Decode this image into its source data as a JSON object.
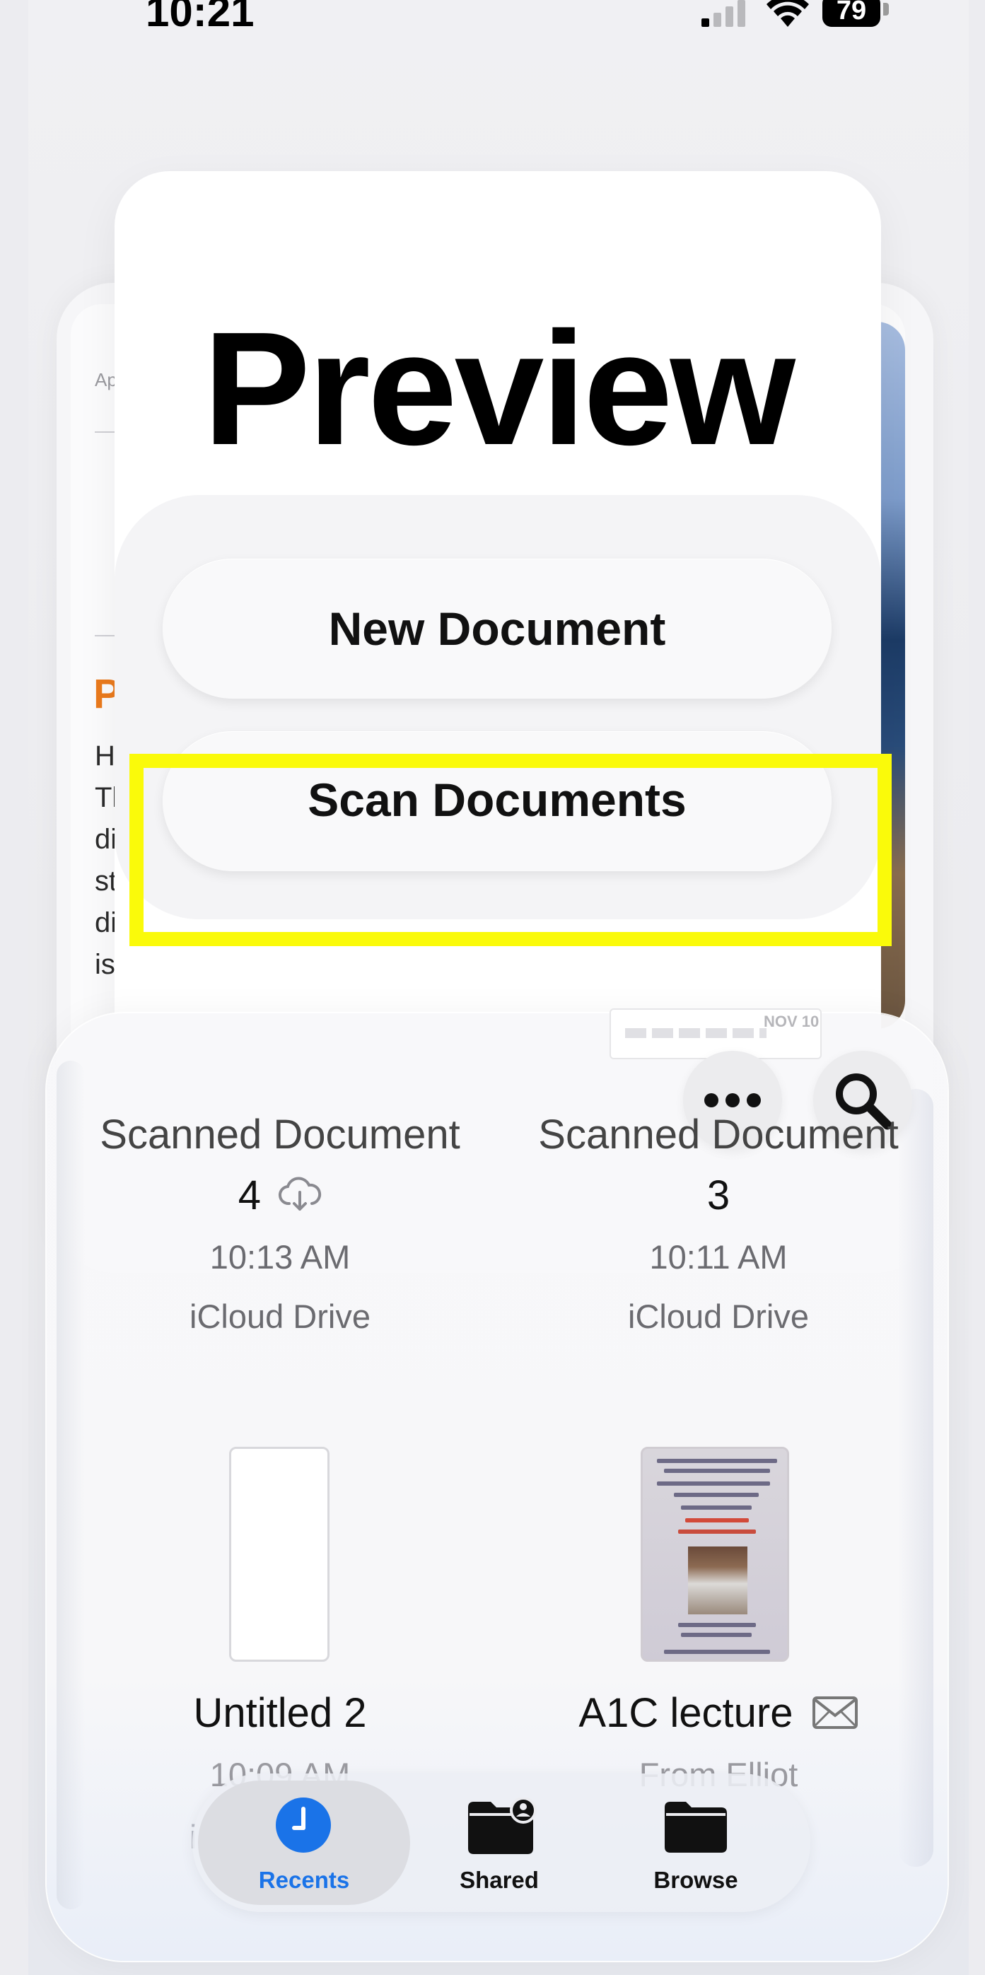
{
  "status_bar": {
    "time": "10:21",
    "battery_level": "79",
    "signal_icon": "cellular-signal-icon",
    "wifi_icon": "wifi-icon"
  },
  "background_document": {
    "header_fragment": "Ap",
    "heading_fragment": "P",
    "line_fragments": [
      "H",
      "Tl",
      "di",
      "st",
      "di",
      "is"
    ],
    "accent_color": "#ea7a1c"
  },
  "preview": {
    "title": "Preview",
    "new_document_label": "New Document",
    "scan_documents_label": "Scan Documents",
    "highlight_color": "#fafa0a"
  },
  "files": {
    "thumb_date": "NOV 10",
    "more_icon": "ellipsis-icon",
    "search_icon": "magnifying-glass-icon",
    "items": [
      {
        "name_line1": "Scanned Document",
        "name_line2": "4",
        "time": "10:13 AM",
        "location": "iCloud Drive",
        "badge_icon": "cloud-download-icon"
      },
      {
        "name_line1": "Scanned Document",
        "name_line2": "3",
        "time": "10:11 AM",
        "location": "iCloud Drive"
      },
      {
        "name": "Untitled 2",
        "time": "10:09 AM",
        "location": "iCloud Drive"
      },
      {
        "name": "A1C lecture",
        "badge_icon": "envelope-icon",
        "location": "From Elliot"
      }
    ]
  },
  "tab_bar": {
    "tabs": [
      {
        "label": "Recents",
        "icon": "clock-icon",
        "selected": true
      },
      {
        "label": "Shared",
        "icon": "shared-folder-icon",
        "selected": false
      },
      {
        "label": "Browse",
        "icon": "folder-icon",
        "selected": false
      }
    ],
    "accent_color": "#1a73e8"
  }
}
